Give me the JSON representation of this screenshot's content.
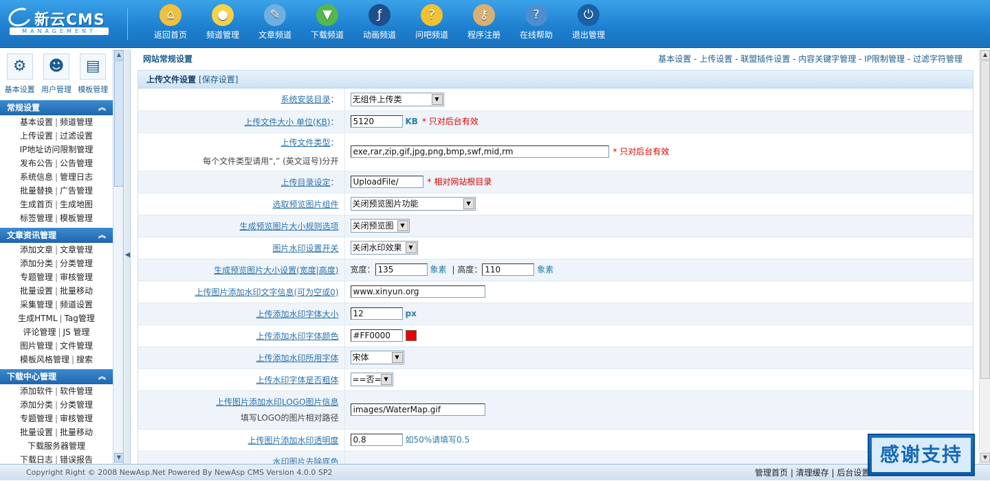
{
  "header": {
    "logo_name": "新云CMS",
    "logo_sub": "MANAGEMENT",
    "nav": [
      {
        "label": "返回首页",
        "icon": "home-icon",
        "color": "#f0c040"
      },
      {
        "label": "频道管理",
        "icon": "lightbulb-icon",
        "color": "#f4d24a"
      },
      {
        "label": "文章频道",
        "icon": "article-icon",
        "color": "#6fb0e0"
      },
      {
        "label": "下载频道",
        "icon": "download-icon",
        "color": "#55b84a"
      },
      {
        "label": "动画频道",
        "icon": "flash-icon",
        "color": "#1d4f8c"
      },
      {
        "label": "问吧频道",
        "icon": "question-icon",
        "color": "#f1c232"
      },
      {
        "label": "程序注册",
        "icon": "key-icon",
        "color": "#d8b070"
      },
      {
        "label": "在线帮助",
        "icon": "help-icon",
        "color": "#4e8ed0"
      },
      {
        "label": "退出管理",
        "icon": "power-icon",
        "color": "#1a5fa8"
      }
    ]
  },
  "quick": [
    {
      "label": "基本设置",
      "icon": "gears-icon"
    },
    {
      "label": "用户管理",
      "icon": "user-icon"
    },
    {
      "label": "模板管理",
      "icon": "template-icon"
    }
  ],
  "sidebar": [
    {
      "title": "常规设置",
      "rows": [
        [
          "基本设置",
          "频道管理"
        ],
        [
          "上传设置",
          "过滤设置"
        ],
        [
          "IP地址访问限制管理"
        ],
        [
          "发布公告",
          "公告管理"
        ],
        [
          "系统信息",
          "管理日志"
        ],
        [
          "批量替换",
          "广告管理"
        ],
        [
          "生成首页",
          "生成地图"
        ],
        [
          "标签管理",
          "模板管理"
        ]
      ]
    },
    {
      "title": "文章资讯管理",
      "rows": [
        [
          "添加文章",
          "文章管理"
        ],
        [
          "添加分类",
          "分类管理"
        ],
        [
          "专题管理",
          "审核管理"
        ],
        [
          "批量设置",
          "批量移动"
        ],
        [
          "采集管理",
          "频道设置"
        ],
        [
          "生成HTML",
          "Tag管理"
        ],
        [
          "评论管理",
          "JS 管理"
        ],
        [
          "图片管理",
          "文件管理"
        ],
        [
          "模板风格管理",
          "搜索"
        ]
      ]
    },
    {
      "title": "下载中心管理",
      "rows": [
        [
          "添加软件",
          "软件管理"
        ],
        [
          "添加分类",
          "分类管理"
        ],
        [
          "专题管理",
          "审核管理"
        ],
        [
          "批量设置",
          "批量移动"
        ],
        [
          "下载服务器管理"
        ],
        [
          "下载日志",
          "错误报告"
        ]
      ]
    }
  ],
  "main": {
    "title": "网站常规设置",
    "links": "基本设置 - 上传设置 - 联盟插件设置 - 内容关键字管理 - IP限制管理 - 过滤字符管理",
    "panel_title": "上传文件设置",
    "save": "[保存设置]",
    "fields": {
      "install_dir": {
        "label": "系统安装目录",
        "value": "无组件上传类"
      },
      "file_size": {
        "label": "上传文件大小 单位(KB)",
        "value": "5120",
        "unit": "KB",
        "note": "* 只对后台有效"
      },
      "file_types": {
        "label": "上传文件类型",
        "hint": "每个文件类型请用“,” (英文逗号)分开",
        "value": "exe,rar,zip,gif,jpg,png,bmp,swf,mid,rm",
        "note": "* 只对后台有效"
      },
      "upload_dir": {
        "label": "上传目录设定",
        "value": "UploadFile/",
        "note": "* 相对网站根目录"
      },
      "preview_component": {
        "label": "选取预览图片组件",
        "value": "关闭预览图片功能"
      },
      "preview_rule": {
        "label": "生成预览图片大小规则选项",
        "value": "关闭预览图"
      },
      "watermark_switch": {
        "label": "图片水印设置开关",
        "value": "关闭水印效果"
      },
      "preview_size": {
        "label": "生成预览图片大小设置(宽度|高度)",
        "width_label": "宽度：",
        "width": "135",
        "px1": "象素",
        "height_label": "| 高度：",
        "height": "110",
        "px2": "象素"
      },
      "wm_text": {
        "label": "上传图片添加水印文字信息(可为空或0)",
        "value": "www.xinyun.org"
      },
      "wm_font_size": {
        "label": "上传添加水印字体大小",
        "value": "12",
        "unit": "px"
      },
      "wm_font_color": {
        "label": "上传添加水印字体颜色",
        "value": "#FF0000"
      },
      "wm_font": {
        "label": "上传添加水印所用字体",
        "value": "宋体"
      },
      "wm_bold": {
        "label": "上传水印字体是否粗体",
        "value": "==否=="
      },
      "wm_logo": {
        "label": "上传图片添加水印LOGO图片信息",
        "hint": "填写LOGO的图片相对路径",
        "value": "images/WaterMap.gif"
      },
      "wm_opacity": {
        "label": "上传图片添加水印透明度",
        "value": "0.8",
        "note": "如50%请填写0.5"
      },
      "wm_bg": {
        "label": "水印图片去除底色"
      }
    }
  },
  "footer": {
    "copyright": "Copyright Right © 2008 NewAsp.Net Powered By NewAsp CMS Version 4.0.0 SP2",
    "links": "管理首页 | 清理缓存 | 后台设置"
  },
  "badge": "感谢支持"
}
